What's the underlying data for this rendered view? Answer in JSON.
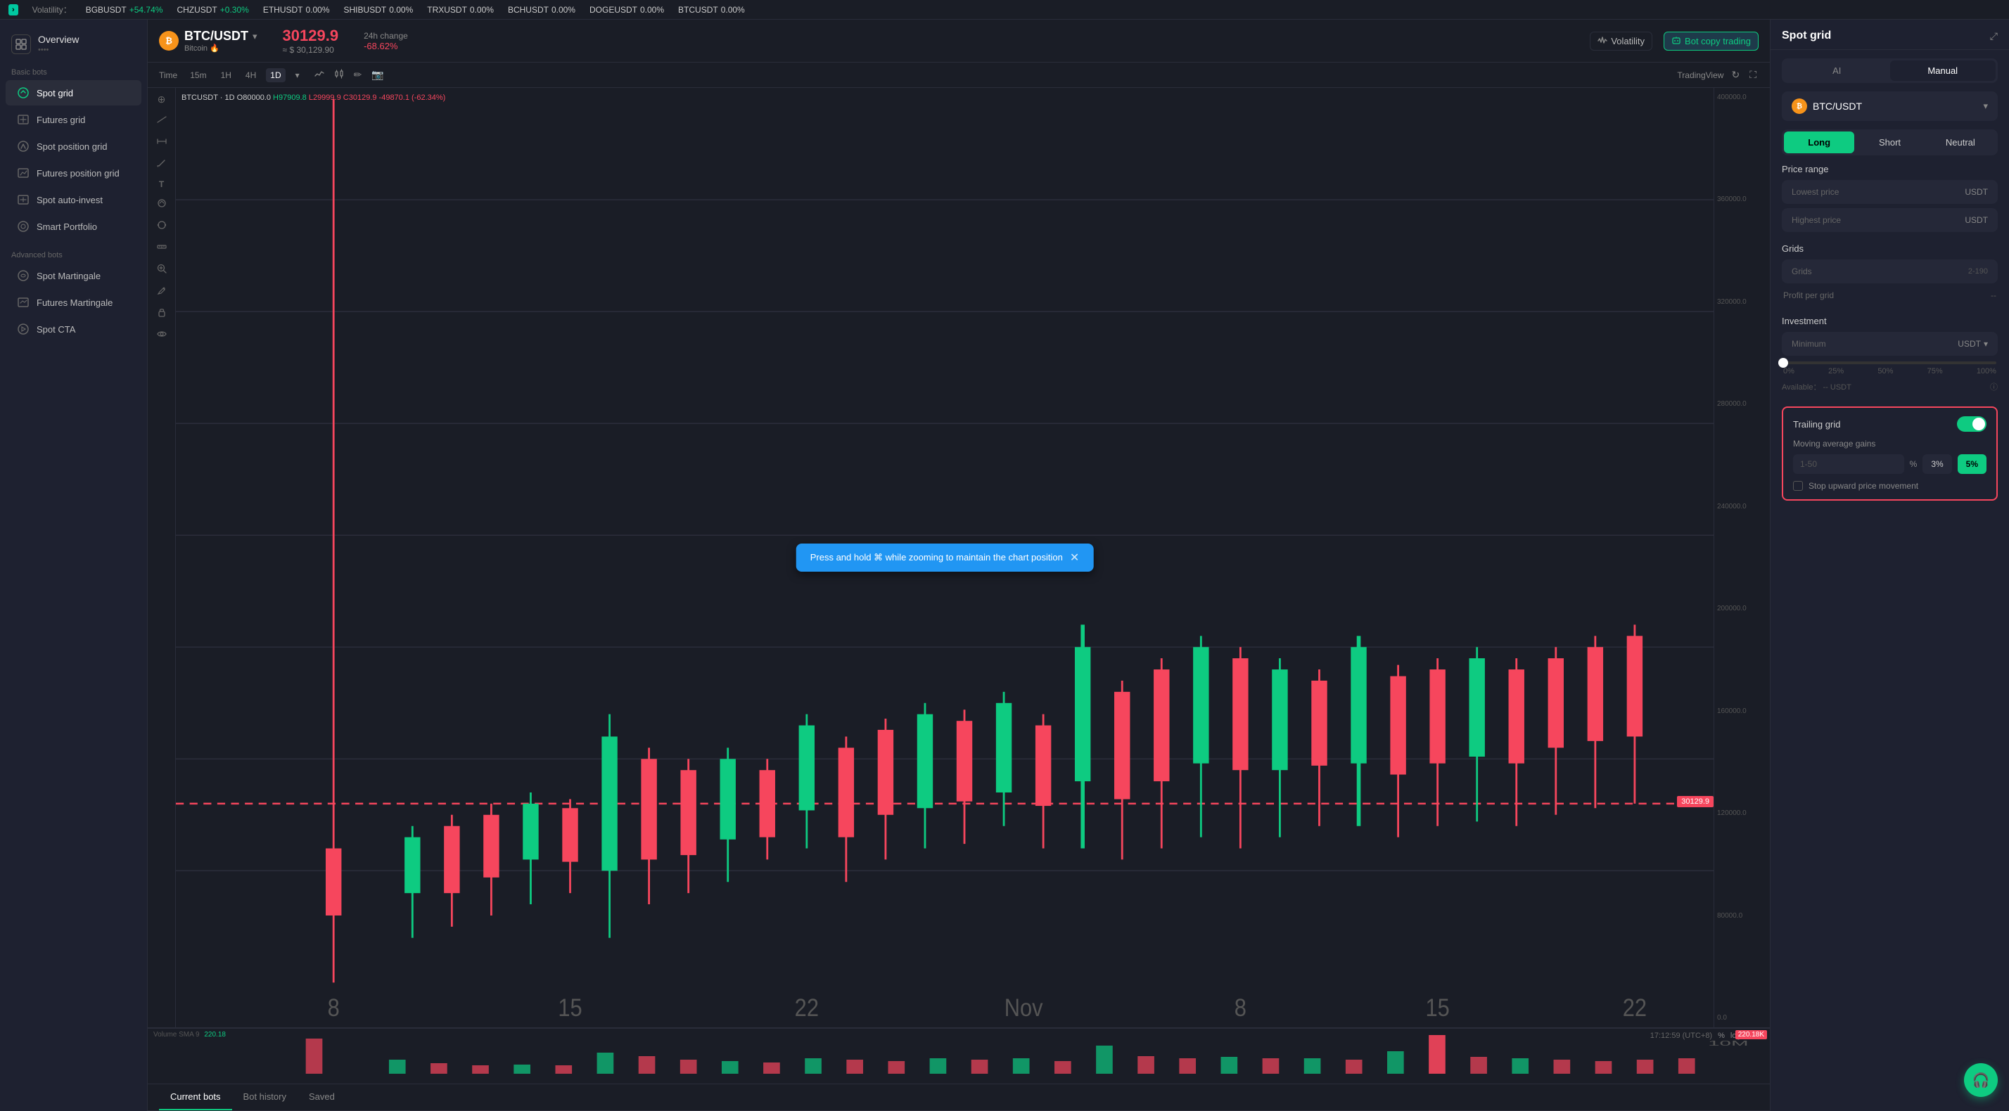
{
  "ticker": {
    "nav_arrow": "›",
    "volatility_label": "Volatility：",
    "items": [
      {
        "symbol": "BGBUSDT",
        "change": "+54.74%",
        "dir": "up"
      },
      {
        "symbol": "CHZUSDT",
        "change": "+0.30%",
        "dir": "up"
      },
      {
        "symbol": "ETHUSDT",
        "change": "0.00%",
        "dir": "neutral"
      },
      {
        "symbol": "SHIBUSDT",
        "change": "0.00%",
        "dir": "neutral"
      },
      {
        "symbol": "TRXUSDT",
        "change": "0.00%",
        "dir": "neutral"
      },
      {
        "symbol": "BCHUSDT",
        "change": "0.00%",
        "dir": "neutral"
      },
      {
        "symbol": "DOGEUSDT",
        "change": "0.00%",
        "dir": "neutral"
      },
      {
        "symbol": "BTCUSDT",
        "change": "0.00%",
        "dir": "neutral"
      }
    ]
  },
  "sidebar": {
    "overview_label": "Overview",
    "overview_sub": "••••",
    "basic_label": "Basic bots",
    "items_basic": [
      {
        "id": "spot-grid",
        "label": "Spot grid",
        "active": true
      },
      {
        "id": "futures-grid",
        "label": "Futures grid",
        "active": false
      },
      {
        "id": "spot-position",
        "label": "Spot position grid",
        "active": false
      },
      {
        "id": "futures-position",
        "label": "Futures position grid",
        "active": false
      },
      {
        "id": "spot-auto-invest",
        "label": "Spot auto-invest",
        "active": false
      },
      {
        "id": "smart-portfolio",
        "label": "Smart Portfolio",
        "active": false
      }
    ],
    "advanced_label": "Advanced bots",
    "items_advanced": [
      {
        "id": "spot-martingale",
        "label": "Spot Martingale",
        "active": false
      },
      {
        "id": "futures-martingale",
        "label": "Futures Martingale",
        "active": false
      },
      {
        "id": "spot-cta",
        "label": "Spot CTA",
        "active": false
      }
    ]
  },
  "chart": {
    "pair": "BTC/USDT",
    "pair_arrow": "▾",
    "pair_sub": "Bitcoin",
    "fire": "🔥",
    "price": "30129.9",
    "price_usd": "≈ $ 30,129.90",
    "change_label": "24h change",
    "change_val": "-68.62%",
    "volatility_btn": "Volatility",
    "bot_copy_btn": "Bot copy trading",
    "ohlc": "BTCUSDT · 1D  O80000.0  H97909.8  L29999.9  C30129.9  -49870.1 (-62.34%)",
    "price_tag": "30129.9",
    "y_labels": [
      "400000.0",
      "360000.0",
      "320000.0",
      "280000.0",
      "240000.0",
      "200000.0",
      "160000.0",
      "120000.0",
      "80000.0",
      "0.0"
    ],
    "time_options": [
      "15m",
      "1H",
      "4H",
      "1D"
    ],
    "active_time": "1D",
    "time_label": "Time",
    "tradingview_label": "TradingView",
    "tooltip_text": "Press and hold ⌘ while zooming to maintain the chart position",
    "timestamp": "17:12:59 (UTC+8)",
    "x_labels": [
      "8",
      "15",
      "22",
      "Nov",
      "8",
      "15",
      "22"
    ],
    "volume_label": "Volume SMA 9",
    "volume_sma": "220.18",
    "volume_val": "220.18K",
    "ten_m_label": "10M"
  },
  "tabs": {
    "items": [
      "Current bots",
      "Bot history",
      "Saved"
    ],
    "active": "Current bots"
  },
  "right_panel": {
    "title": "Spot grid",
    "mode_tabs": [
      "AI",
      "Manual"
    ],
    "active_mode": "Manual",
    "pair": "BTC/USDT",
    "directions": [
      "Long",
      "Short",
      "Neutral"
    ],
    "active_dir": "Long",
    "price_range_title": "Price range",
    "lowest_price_label": "Lowest price",
    "lowest_price_currency": "USDT",
    "highest_price_label": "Highest price",
    "highest_price_currency": "USDT",
    "grids_title": "Grids",
    "grids_label": "Grids",
    "grids_hint": "2-190",
    "profit_label": "Profit per grid",
    "profit_val": "--",
    "investment_title": "Investment",
    "minimum_label": "Minimum",
    "currency": "USDT",
    "slider_pcts": [
      "0%",
      "25%",
      "50%",
      "75%",
      "100%"
    ],
    "available_label": "Available：",
    "available_val": "-- USDT",
    "trailing_title": "Trailing grid",
    "toggle_on": true,
    "ma_gains_title": "Moving average gains",
    "ma_input_placeholder": "1-50",
    "ma_pct": "%",
    "ma_preset1": "3%",
    "ma_preset2": "5%",
    "stop_label": "Stop upward price movement"
  },
  "support": {
    "icon": "🎧"
  }
}
